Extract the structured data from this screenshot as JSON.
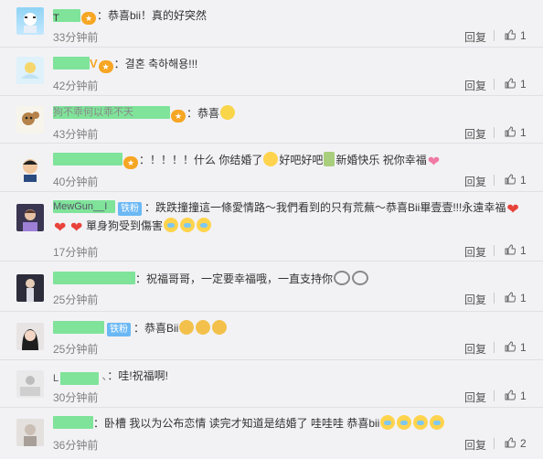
{
  "comments": [
    {
      "name": "T",
      "text": "：恭喜bii！真的好突然",
      "time": "33分钟前",
      "reply": "回复",
      "likes": "1"
    },
    {
      "name": "",
      "text": "：결혼 축하해용!!!",
      "time": "42分钟前",
      "reply": "回复",
      "likes": "1"
    },
    {
      "name": "狗不乖何以乖不天",
      "text": "：恭喜",
      "time": "43分钟前",
      "reply": "回复",
      "likes": "1"
    },
    {
      "name": "",
      "text_a": "：！！！！什么 你结婚了",
      "text_b": "好吧好吧",
      "text_c": "新婚快乐 祝你幸福",
      "time": "40分钟前",
      "reply": "回复",
      "likes": "1"
    },
    {
      "name": "MewGun__I",
      "badge": "铁粉",
      "text_a": "：跌跌撞撞這一條愛情路～我們看到的只有荒蕪～恭喜Bii畢壹壹!!!永遠幸福",
      "text_b": "單身狗受到傷害",
      "time": "17分钟前",
      "reply": "回复",
      "likes": "1"
    },
    {
      "name": "",
      "text": "：祝福哥哥，一定要幸福哦，一直支持你",
      "time": "25分钟前",
      "reply": "回复",
      "likes": "1"
    },
    {
      "name": "",
      "badge": "铁粉",
      "text": "：恭喜Bii",
      "time": "25分钟前",
      "reply": "回复",
      "likes": "1"
    },
    {
      "name": "L",
      "text": "：哇!祝福啊!",
      "time": "30分钟前",
      "reply": "回复",
      "likes": "1"
    },
    {
      "name": "",
      "text": "：卧槽 我以为公布恋情 读完才知道是结婚了 哇哇哇 恭喜bii",
      "time": "36分钟前",
      "reply": "回复",
      "likes": "2"
    }
  ]
}
